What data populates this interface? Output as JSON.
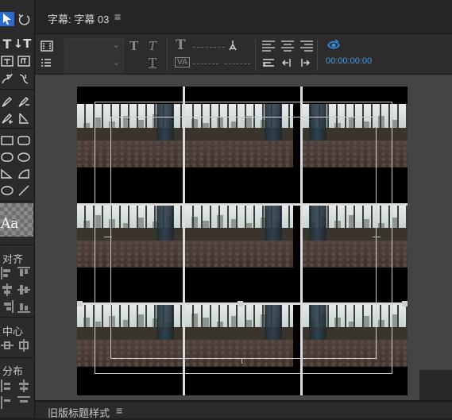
{
  "header": {
    "title": "字幕: 字幕 03",
    "menu_glyph": "≡"
  },
  "tools": {
    "type_label": "T",
    "vtype_label": "↓T",
    "style_swatch_text": "Aa",
    "align_section": "对齐",
    "center_section": "中心",
    "distribute_section": "分布"
  },
  "toolbar": {
    "bold": "T",
    "italic": "T",
    "underline": "T",
    "font_size_glyph": "T",
    "kerning_glyph": "VA",
    "timecode": "00:00:00:00"
  },
  "bottom": {
    "label": "旧版标题样式",
    "menu_glyph": "≡"
  },
  "colors": {
    "accent": "#2b6bd1",
    "timecode": "#4a9be8",
    "panel": "#2c2c2c",
    "canvas_bg": "#444444"
  },
  "icons": [
    "selection-arrow-icon",
    "rotate-icon",
    "type-icon",
    "vertical-type-icon",
    "area-type-icon",
    "vertical-area-type-icon",
    "path-type-icon",
    "vertical-path-type-icon",
    "pen-icon",
    "delete-anchor-icon",
    "add-anchor-icon",
    "convert-anchor-icon",
    "rectangle-icon",
    "rounded-rectangle-icon",
    "clipped-rectangle-icon",
    "rounded-corner-icon",
    "wedge-icon",
    "arc-icon",
    "ellipse-icon",
    "line-icon",
    "eye-icon"
  ]
}
